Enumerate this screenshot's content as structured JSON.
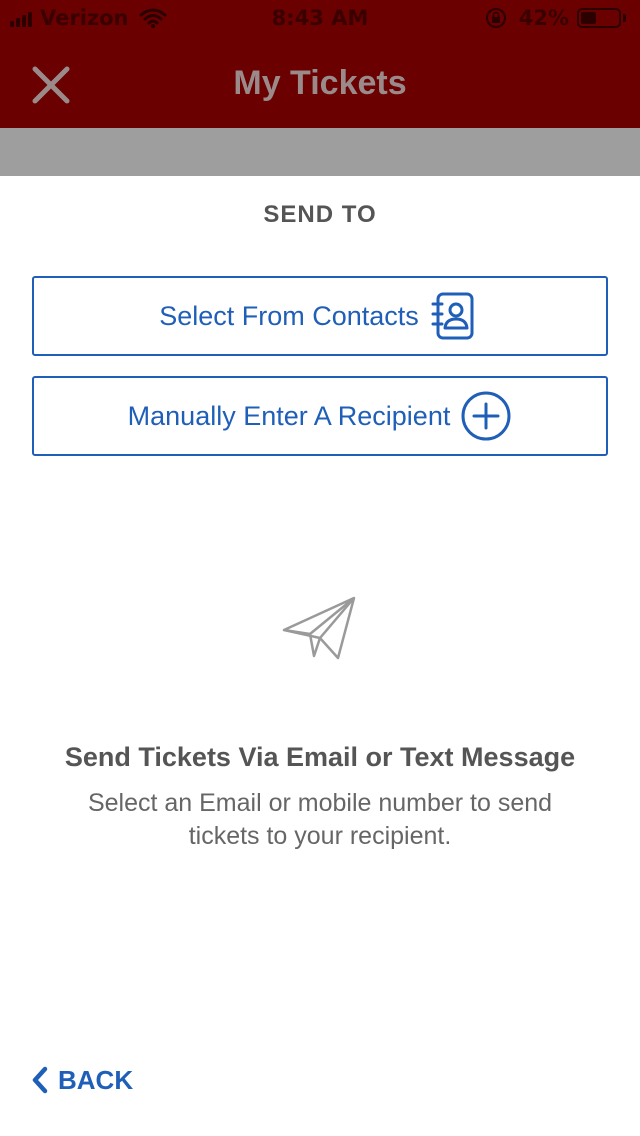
{
  "status_bar": {
    "carrier": "Verizon",
    "time": "8:43 AM",
    "battery_percent": "42%",
    "battery_level": 0.42,
    "icons": [
      "signal-icon",
      "wifi-icon",
      "orientation-lock-icon",
      "battery-icon"
    ]
  },
  "nav": {
    "title": "My Tickets",
    "close_icon": "close-icon"
  },
  "send": {
    "section_title": "SEND TO",
    "contacts_label": "Select From Contacts",
    "contacts_icon": "contacts-book-icon",
    "manual_label": "Manually Enter A Recipient",
    "manual_icon": "plus-circle-icon"
  },
  "empty_state": {
    "icon": "paper-plane-icon",
    "title": "Send Tickets Via Email or Text Message",
    "description": "Select an Email or mobile number to send tickets to your recipient."
  },
  "footer": {
    "back_label": "BACK",
    "back_icon": "chevron-left-icon"
  },
  "colors": {
    "header": "#6b0000",
    "accent": "#1f5fb8",
    "band": "#9e9e9e",
    "text": "#555555"
  }
}
